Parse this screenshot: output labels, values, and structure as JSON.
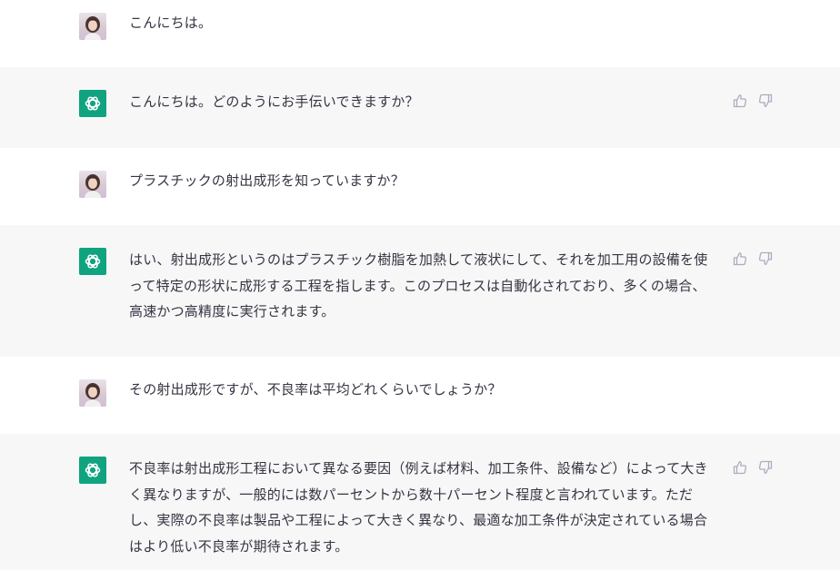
{
  "conversation": {
    "messages": [
      {
        "role": "user",
        "text": "こんにちは。"
      },
      {
        "role": "assistant",
        "text": "こんにちは。どのようにお手伝いできますか？"
      },
      {
        "role": "user",
        "text": "プラスチックの射出成形を知っていますか？"
      },
      {
        "role": "assistant",
        "text": "はい、射出成形というのはプラスチック樹脂を加熱して液状にして、それを加工用の設備を使って特定の形状に成形する工程を指します。このプロセスは自動化されており、多くの場合、高速かつ高精度に実行されます。"
      },
      {
        "role": "user",
        "text": "その射出成形ですが、不良率は平均どれくらいでしょうか？"
      },
      {
        "role": "assistant",
        "text": "不良率は射出成形工程において異なる要因（例えば材料、加工条件、設備など）によって大きく異なりますが、一般的には数パーセントから数十パーセント程度と言われています。ただし、実際の不良率は製品や工程によって大きく異なり、最適な加工条件が決定されている場合はより低い不良率が期待されます。"
      }
    ]
  },
  "icons": {
    "assistant_avatar": "openai-logo-icon",
    "thumbs_up": "thumbs-up-icon",
    "thumbs_down": "thumbs-down-icon"
  },
  "colors": {
    "assistant_avatar_bg": "#10a37f",
    "assistant_row_bg": "#f7f7f8",
    "user_row_bg": "#ffffff",
    "text": "#343541",
    "icon": "#acacbe"
  }
}
